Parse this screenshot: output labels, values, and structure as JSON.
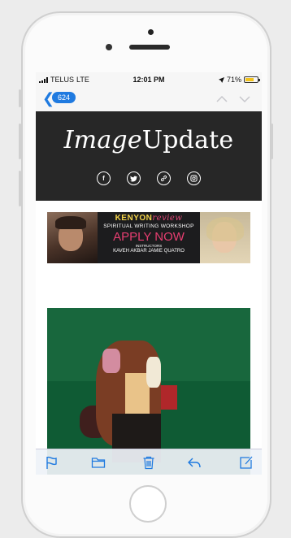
{
  "status_bar": {
    "carrier": "TELUS",
    "network": "LTE",
    "time": "12:01 PM",
    "battery_percent": "71%",
    "battery_level": 0.71
  },
  "nav": {
    "back_count": "624",
    "icons": [
      "chevron-left-icon",
      "chevron-up-icon",
      "chevron-down-icon"
    ],
    "accent_color": "#1f7ae0"
  },
  "newsletter": {
    "logo_italic": "Image",
    "logo_regular": "Update",
    "social_icons": [
      "facebook-icon",
      "twitter-icon",
      "link-icon",
      "instagram-icon"
    ],
    "header_color": "#272727"
  },
  "ad": {
    "brand_bold": "KENYON",
    "brand_italic": "review",
    "subtitle": "SPIRITUAL WRITING WORKSHOP",
    "cta": "APPLY NOW",
    "instructors_label": "INSTRUCTORS",
    "names": "KAVEH AKBAR   JAMIE QUATRO"
  },
  "toolbar": {
    "icons": [
      "flag-icon",
      "folder-icon",
      "trash-icon",
      "reply-icon",
      "compose-icon"
    ]
  }
}
